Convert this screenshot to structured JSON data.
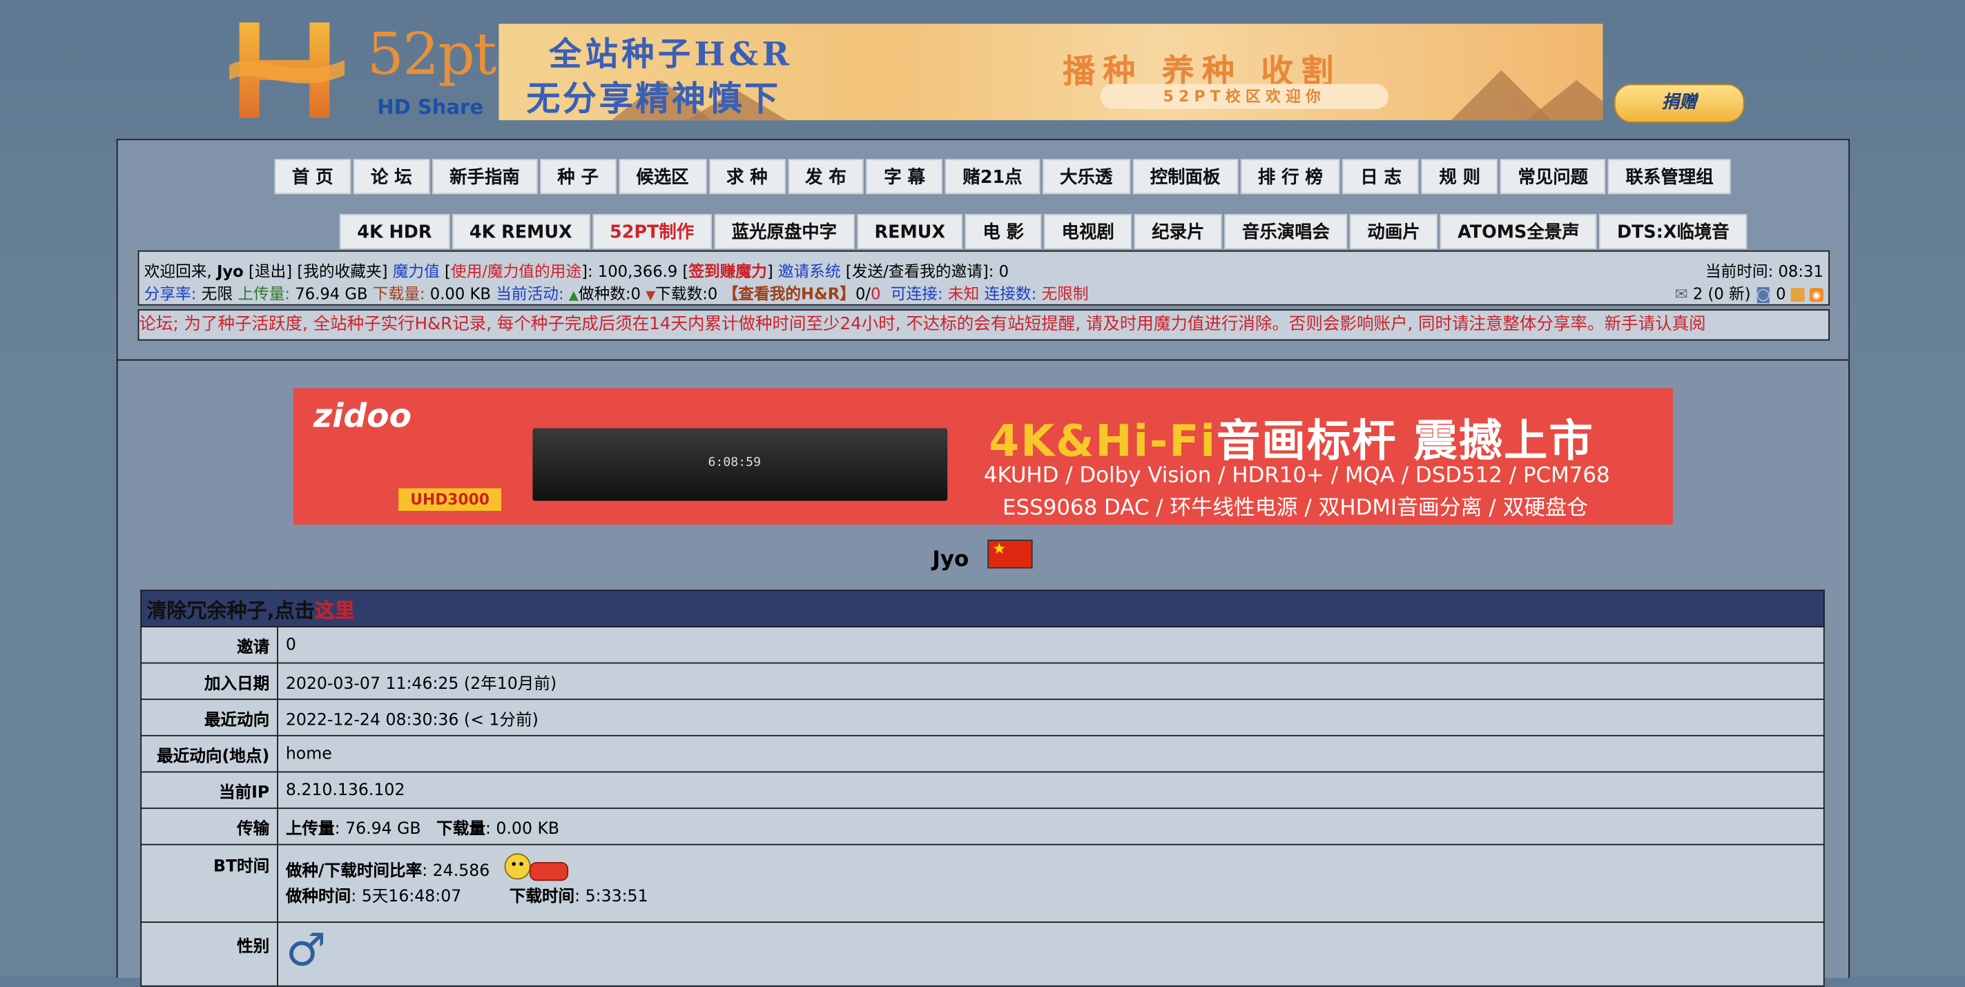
{
  "header": {
    "logo_text": "52pt",
    "logo_sub": "HD Share",
    "banner": {
      "line1": "全站种子H&R",
      "line2": "无分享精神慎下",
      "right_line": "播种 养种 收割",
      "right_badge": "52PT校区欢迎你"
    },
    "donate_label": "捐赠"
  },
  "nav_primary": [
    "首 页",
    "论 坛",
    "新手指南",
    "种 子",
    "候选区",
    "求 种",
    "发 布",
    "字 幕",
    "赌21点",
    "大乐透",
    "控制面板",
    "排 行 榜",
    "日 志",
    "规 则",
    "常见问题",
    "联系管理组"
  ],
  "nav_secondary": [
    {
      "label": "4K HDR",
      "highlight": false
    },
    {
      "label": "4K REMUX",
      "highlight": false
    },
    {
      "label": "52PT制作",
      "highlight": true
    },
    {
      "label": "蓝光原盘中字",
      "highlight": false
    },
    {
      "label": "REMUX",
      "highlight": false
    },
    {
      "label": "电 影",
      "highlight": false
    },
    {
      "label": "电视剧",
      "highlight": false
    },
    {
      "label": "纪录片",
      "highlight": false
    },
    {
      "label": "音乐演唱会",
      "highlight": false
    },
    {
      "label": "动画片",
      "highlight": false
    },
    {
      "label": "ATOMS全景声",
      "highlight": false
    },
    {
      "label": "DTS:X临境音",
      "highlight": false
    }
  ],
  "userbar": {
    "welcome": "欢迎回来,",
    "username": "Jyo",
    "logout": "[退出]",
    "favorites": "[我的收藏夹]",
    "bonus_label": "魔力值",
    "bonus_use": "使用/魔力值的用途",
    "bonus_value": ": 100,366.9",
    "signin": "签到赚魔力",
    "invite_system": "邀请系统",
    "invite_send": "[发送/查看我的邀请]: 0",
    "current_time_label": "当前时间:",
    "current_time": "08:31",
    "ratio_label": "分享率:",
    "ratio_value": "无限",
    "uploaded_label": "上传量:",
    "uploaded_value": "76.94 GB",
    "downloaded_label": "下载量:",
    "downloaded_value": "0.00 KB",
    "activity_label": "当前活动:",
    "seeding": "做种数:0",
    "leeching": "下载数:0",
    "hr_label": "【查看我的H&R】",
    "hr_value_a": "0/",
    "hr_value_b": "0",
    "connectable_label": "可连接:",
    "connectable_value": "未知",
    "connections_label": "连接数:",
    "connections_value": "无限制",
    "messages": "2 (0 新)",
    "msg_extra": "0"
  },
  "marquee_text": "论坛; 为了种子活跃度, 全站种子实行H&R记录, 每个种子完成后须在14天内累计做种时间至少24小时, 不达标的会有站短提醒, 请及时用魔力值进行消除。否则会影响账户, 同时请注意整体分享率。新手请认真阅",
  "ad": {
    "brand": "zidoo",
    "model": "UHD3000",
    "device_display": "6:08:59",
    "headline_accent": "4K&Hi-Fi",
    "headline_rest": "音画标杆 震撼上市",
    "spec1": "4KUHD / Dolby Vision / HDR10+ / MQA / DSD512 / PCM768",
    "spec2": "ESS9068 DAC / 环牛线性电源 / 双HDMI音画分离 / 双硬盘仓"
  },
  "profile": {
    "username": "Jyo",
    "notice_prefix": "清除冗余种子,点击",
    "notice_link": "这里",
    "rows": {
      "invite_label": "邀请",
      "invite_value": "0",
      "join_label": "加入日期",
      "join_value": "2020-03-07 11:46:25 (2年10月前)",
      "last_label": "最近动向",
      "last_value": "2022-12-24 08:30:36 (< 1分前)",
      "lastloc_label": "最近动向(地点)",
      "lastloc_value": "home",
      "ip_label": "当前IP",
      "ip_value": "8.210.136.102",
      "transfer_label": "传输",
      "transfer_up_label": "上传量",
      "transfer_up_value": ": 76.94 GB",
      "transfer_down_label": "下载量",
      "transfer_down_value": ": 0.00 KB",
      "bt_label": "BT时间",
      "bt_ratio_label": "做种/下载时间比率",
      "bt_ratio_value": ": 24.586",
      "bt_seed_label": "做种时间",
      "bt_seed_value": ": 5天16:48:07",
      "bt_dl_label": "下载时间",
      "bt_dl_value": ": 5:33:51",
      "gender_label": "性别",
      "gender_icon": "♂"
    }
  },
  "colors": {
    "page_bg": "#617b94",
    "panel_bg": "#c6d0da",
    "header_row": "#2f3d6a",
    "link_blue": "#1b3ec7",
    "link_red": "#d0202a"
  }
}
